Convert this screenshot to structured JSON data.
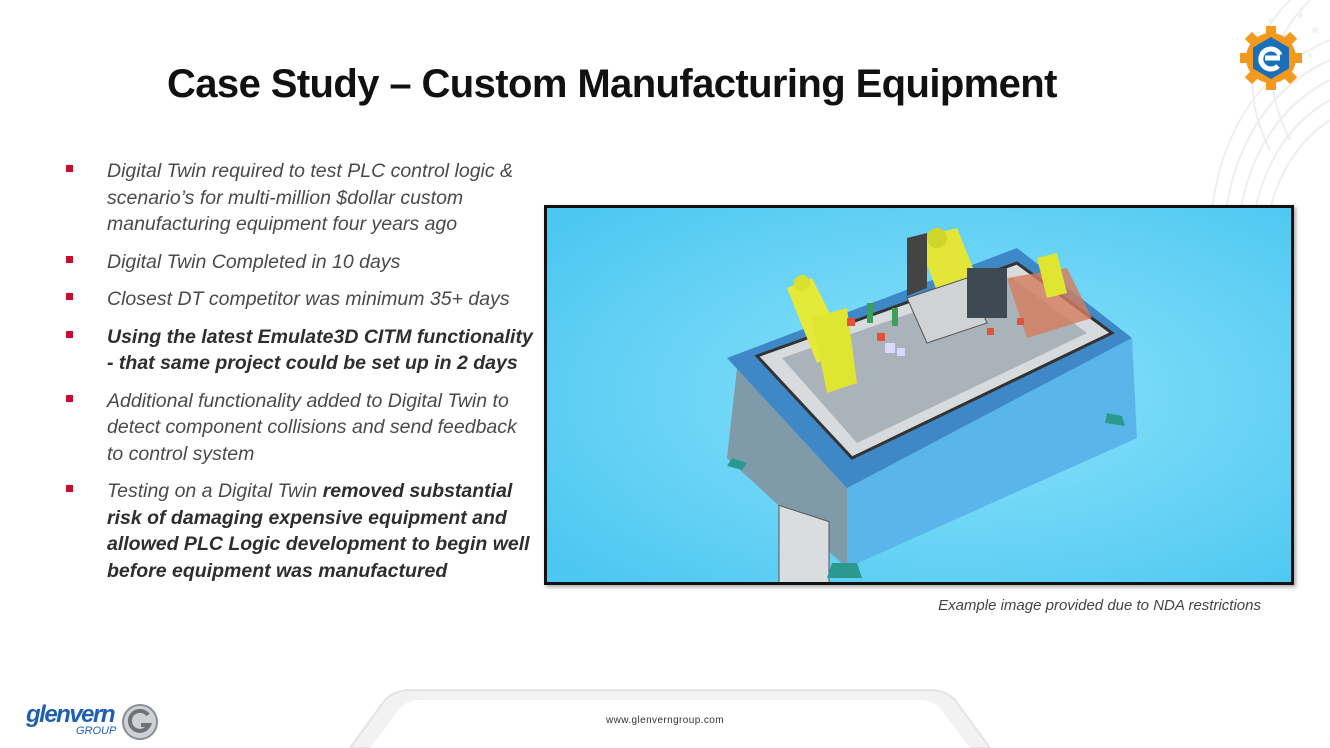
{
  "slide": {
    "title": "Case Study – Custom Manufacturing Equipment",
    "bullets": [
      {
        "text": "Digital Twin required to test PLC control logic & scenario’s for multi-million $dollar custom manufacturing equipment four years ago"
      },
      {
        "text": "Digital Twin Completed in 10 days"
      },
      {
        "text": "Closest DT competitor was minimum 35+ days"
      },
      {
        "bold": "Using the latest Emulate3D CITM functionality - that same project could be set up in 2 days"
      },
      {
        "text": "Additional functionality added to Digital Twin to detect component collisions and send feedback to control system"
      },
      {
        "text": "Testing on a Digital Twin ",
        "bold": "removed substantial risk of damaging expensive equipment and allowed PLC Logic development to begin well before equipment was manufactured"
      }
    ],
    "caption": "Example image provided due to NDA restrictions"
  },
  "footer": {
    "website": "www.glenverngroup.com",
    "company_logo_word": "glenvern",
    "company_logo_sub": "GROUP"
  },
  "icons": {
    "brand_logo": "emulate3d-gear-logo",
    "company_logo": "glenvern-g-logo"
  },
  "colors": {
    "bullet": "#c8102e",
    "brand_blue": "#1a6fb8",
    "brand_orange": "#f39a1e",
    "photo_background": "#5fd0f5"
  }
}
